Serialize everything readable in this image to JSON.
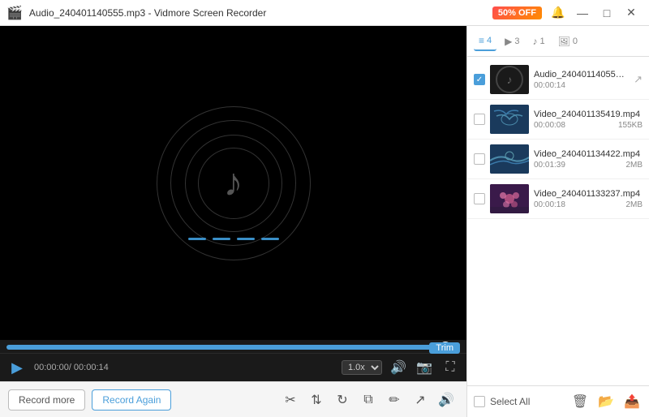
{
  "titleBar": {
    "title": "Audio_240401140555.mp3 - Vidmore Screen Recorder",
    "giftLabel": "50% OFF",
    "minBtn": "—",
    "maxBtn": "□",
    "closeBtn": "✕"
  },
  "tabs": [
    {
      "icon": "≡",
      "count": "4",
      "id": "list",
      "active": true
    },
    {
      "icon": "▶",
      "count": "3",
      "id": "video"
    },
    {
      "icon": "♪",
      "count": "1",
      "id": "audio"
    },
    {
      "icon": "🖼",
      "count": "0",
      "id": "image"
    }
  ],
  "files": [
    {
      "name": "Audio_240401140555.mp3",
      "duration": "00:00:14",
      "size": "",
      "type": "audio",
      "checked": true
    },
    {
      "name": "Video_240401135419.mp4",
      "duration": "00:00:08",
      "size": "155KB",
      "type": "video-birds",
      "checked": false
    },
    {
      "name": "Video_240401134422.mp4",
      "duration": "00:01:39",
      "size": "2MB",
      "type": "video-birds",
      "checked": false
    },
    {
      "name": "Video_240401133237.mp4",
      "duration": "00:00:18",
      "size": "2MB",
      "type": "video-flowers",
      "checked": false
    }
  ],
  "player": {
    "timeDisplay": "00:00:00/ 00:00:14",
    "speed": "1.0x",
    "progressPercent": 96,
    "trimLabel": "Trim"
  },
  "actions": {
    "recordMoreLabel": "Record more",
    "recordAgainLabel": "Record Again"
  },
  "listControls": {
    "selectAllLabel": "Select All"
  }
}
